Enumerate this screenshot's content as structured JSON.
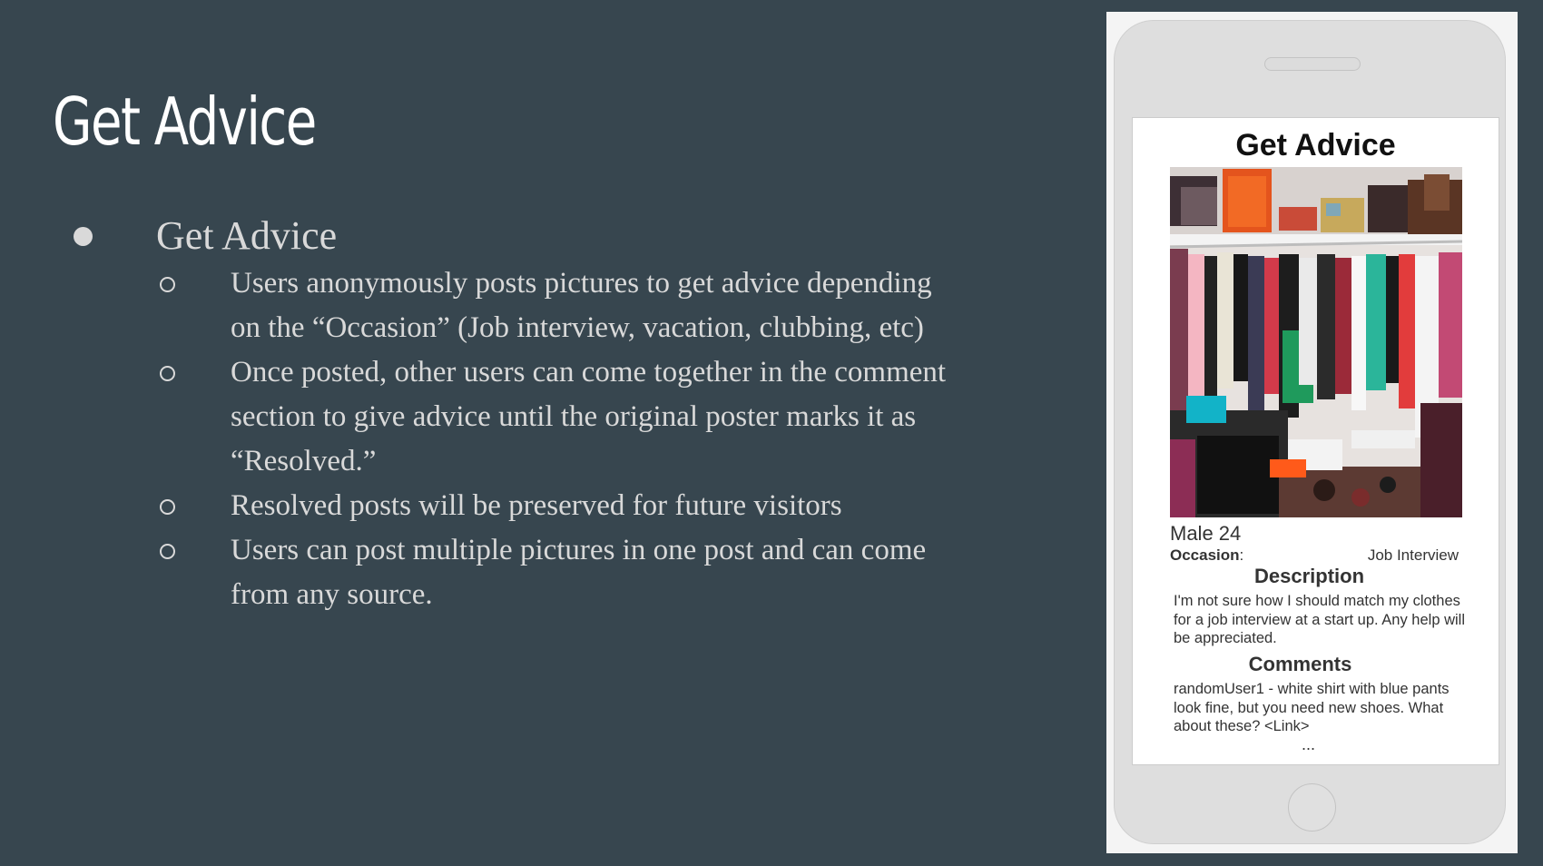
{
  "slide": {
    "title": "Get Advice",
    "bullet": {
      "label": "Get Advice",
      "sub_items": [
        "Users anonymously posts pictures to get advice depending on the “Occasion” (Job interview, vacation, clubbing, etc)",
        "Once posted, other users can come together in the comment section to give advice until the original poster marks it as “Resolved.”",
        "Resolved posts will be preserved for future visitors",
        "Users can post multiple pictures in one post and can come from any source."
      ]
    }
  },
  "phone": {
    "screen_title": "Get Advice",
    "photo_icon": "closet-photo",
    "poster": "Male 24",
    "occasion_label": "Occasion",
    "occasion_colon": ":",
    "occasion_value": "Job Interview",
    "description_title": "Description",
    "description_text": "I'm not sure how I should match my clothes for a job interview at a start up. Any help will be appreciated.",
    "comments_title": "Comments",
    "comment_text": "randomUser1 - white shirt with blue pants look fine, but you need new shoes. What about these? <Link>",
    "ellipsis": "..."
  },
  "colors": {
    "background": "#37464f",
    "title_text": "#ffffff",
    "body_text": "#d9d9d9",
    "phone_body": "#dedede",
    "screen": "#ffffff"
  }
}
